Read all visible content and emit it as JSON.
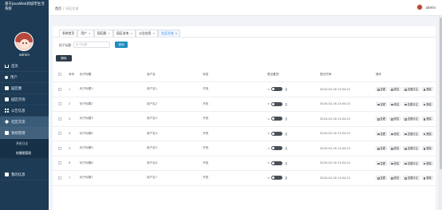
{
  "app_title": "基于JavaWeb的城市生活系统",
  "user": {
    "name": "admin"
  },
  "breadcrumb": {
    "home": "首页",
    "current": "社区交流"
  },
  "sidebar": {
    "items": [
      {
        "label": "首页",
        "icon": "home-icon"
      },
      {
        "label": "用户",
        "icon": "user-icon"
      },
      {
        "label": "园区圈",
        "icon": "square-icon"
      },
      {
        "label": "园区咨询",
        "icon": "square-icon"
      },
      {
        "label": "公告信息",
        "icon": "grid-icon"
      },
      {
        "label": "社区交流",
        "icon": "diamond-icon"
      },
      {
        "label": "系统管理",
        "icon": "square-icon"
      },
      {
        "label": "我的信息",
        "icon": "square-icon"
      }
    ],
    "submenu": [
      {
        "label": "系统日志"
      },
      {
        "label": "轮播图管理"
      }
    ]
  },
  "tabs": [
    {
      "label": "系统首页"
    },
    {
      "label": "用户"
    },
    {
      "label": "园区圈"
    },
    {
      "label": "园区咨询"
    },
    {
      "label": "公告信息"
    },
    {
      "label": "社区交流"
    }
  ],
  "search": {
    "label": "帖子标题",
    "placeholder": "帖子标题",
    "button": "查询"
  },
  "toolbar": {
    "delete_label": "删除"
  },
  "table": {
    "columns": [
      "序号",
      "帖子标题",
      "用户名",
      "状态",
      "是否置顶",
      "提交时间",
      "操作"
    ],
    "rows": [
      {
        "idx": "1",
        "title": "帖子标题1",
        "user": "用户名1",
        "status": "开放",
        "top": "否",
        "time": "2024-02-16 12:04:21"
      },
      {
        "idx": "2",
        "title": "帖子标题2",
        "user": "用户名2",
        "status": "开放",
        "top": "否",
        "time": "2024-02-16 12:04:21"
      },
      {
        "idx": "3",
        "title": "帖子标题3",
        "user": "用户名3",
        "status": "开放",
        "top": "否",
        "time": "2024-02-16 12:04:21"
      },
      {
        "idx": "4",
        "title": "帖子标题4",
        "user": "用户名4",
        "status": "开放",
        "top": "否",
        "time": "2024-02-16 12:04:21"
      },
      {
        "idx": "5",
        "title": "帖子标题5",
        "user": "用户名5",
        "status": "开放",
        "top": "否",
        "time": "2024-02-16 12:04:21"
      },
      {
        "idx": "6",
        "title": "帖子标题6",
        "user": "用户名6",
        "status": "开放",
        "top": "否",
        "time": "2024-02-16 12:04:21"
      },
      {
        "idx": "7",
        "title": "帖子标题7",
        "user": "用户名7",
        "status": "开放",
        "top": "否",
        "time": "2024-02-16 12:04:21"
      }
    ],
    "actions": [
      "查看",
      "修改",
      "查看评论",
      "删除"
    ],
    "top_arrow": "<"
  }
}
